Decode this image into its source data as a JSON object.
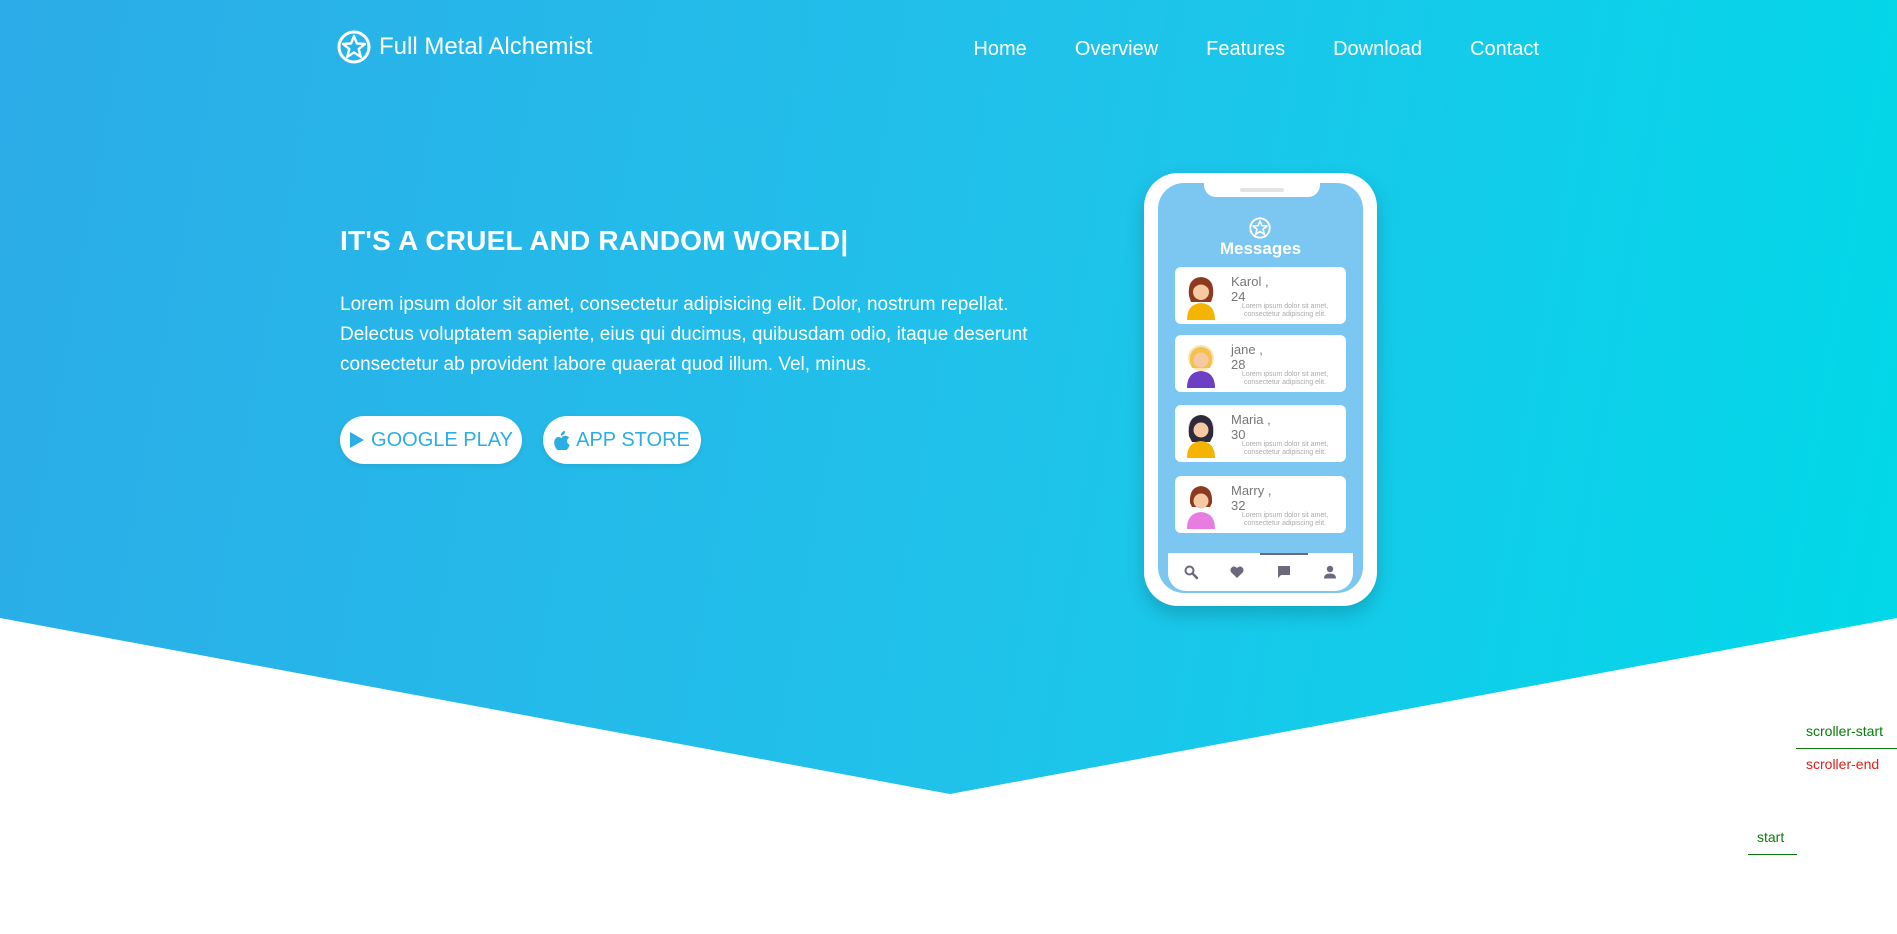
{
  "brand": {
    "name": "Full Metal Alchemist",
    "icon": "star-circle-icon"
  },
  "nav": [
    "Home",
    "Overview",
    "Features",
    "Download",
    "Contact"
  ],
  "hero": {
    "headline": "IT'S A CRUEL AND RANDOM WORLD|",
    "lead": "Lorem ipsum dolor sit amet, consectetur adipisicing elit. Dolor, nostrum repellat. Delectus voluptatem sapiente, eius qui ducimus, quibusdam odio, itaque deserunt consectetur ab provident labore quaerat quod illum. Vel, minus.",
    "buttons": {
      "google_play": "GOOGLE PLAY",
      "app_store": "APP STORE"
    }
  },
  "phone": {
    "title": "Messages",
    "messages": [
      {
        "name": "Karol ,",
        "age": "24",
        "text": "Lorem ipsum dolor sit amet, consectetur adipiscing elit."
      },
      {
        "name": "jane ,",
        "age": "28",
        "text": "Lorem ipsum dolor sit amet, consectetur adipiscing elit."
      },
      {
        "name": "Maria ,",
        "age": "30",
        "text": "Lorem ipsum dolor sit amet, consectetur adipiscing elit."
      },
      {
        "name": "Marry ,",
        "age": "32",
        "text": "Lorem ipsum dolor sit amet, consectetur adipiscing elit."
      }
    ],
    "tabs": [
      "search-icon",
      "heart-icon",
      "chat-icon",
      "person-icon"
    ]
  },
  "markers": {
    "scroller_start": "scroller-start",
    "scroller_end": "scroller-end",
    "start": "start"
  },
  "colors": {
    "gradient_start": "#2cace8",
    "gradient_end": "#00d9e8",
    "button_text": "#2aaee3",
    "phone_screen": "#7bc7f2"
  }
}
